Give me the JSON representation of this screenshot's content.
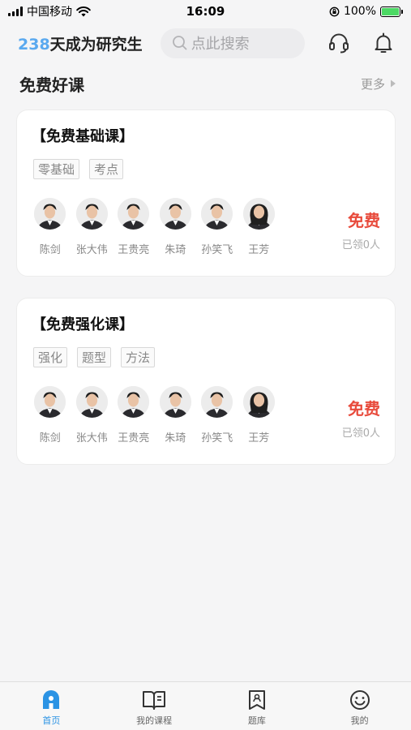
{
  "status_bar": {
    "carrier": "中国移动",
    "time": "16:09",
    "battery_percent": "100%"
  },
  "header": {
    "countdown_days": "238",
    "countdown_text": "天成为研究生",
    "search_placeholder": "点此搜索",
    "icons": [
      "headset-icon",
      "bell-icon"
    ]
  },
  "section": {
    "title": "免费好课",
    "more_label": "更多"
  },
  "courses": [
    {
      "title": "【免费基础课】",
      "tags": [
        "零基础",
        "考点"
      ],
      "teachers": [
        "陈剑",
        "张大伟",
        "王贵亮",
        "朱琦",
        "孙笑飞",
        "王芳"
      ],
      "price": "免费",
      "enrolled": "已领0人"
    },
    {
      "title": "【免费强化课】",
      "tags": [
        "强化",
        "题型",
        "方法"
      ],
      "teachers": [
        "陈剑",
        "张大伟",
        "王贵亮",
        "朱琦",
        "孙笑飞",
        "王芳"
      ],
      "price": "免费",
      "enrolled": "已领0人"
    }
  ],
  "tab_bar": {
    "tabs": [
      {
        "label": "首页",
        "icon": "home-icon",
        "active": true
      },
      {
        "label": "我的课程",
        "icon": "book-icon",
        "active": false
      },
      {
        "label": "题库",
        "icon": "bookmark-icon",
        "active": false
      },
      {
        "label": "我的",
        "icon": "smile-icon",
        "active": false
      }
    ]
  },
  "colors": {
    "accent": "#2b93e4",
    "countdown": "#5aa9ef",
    "price": "#e84b3c",
    "battery": "#4cd964"
  }
}
